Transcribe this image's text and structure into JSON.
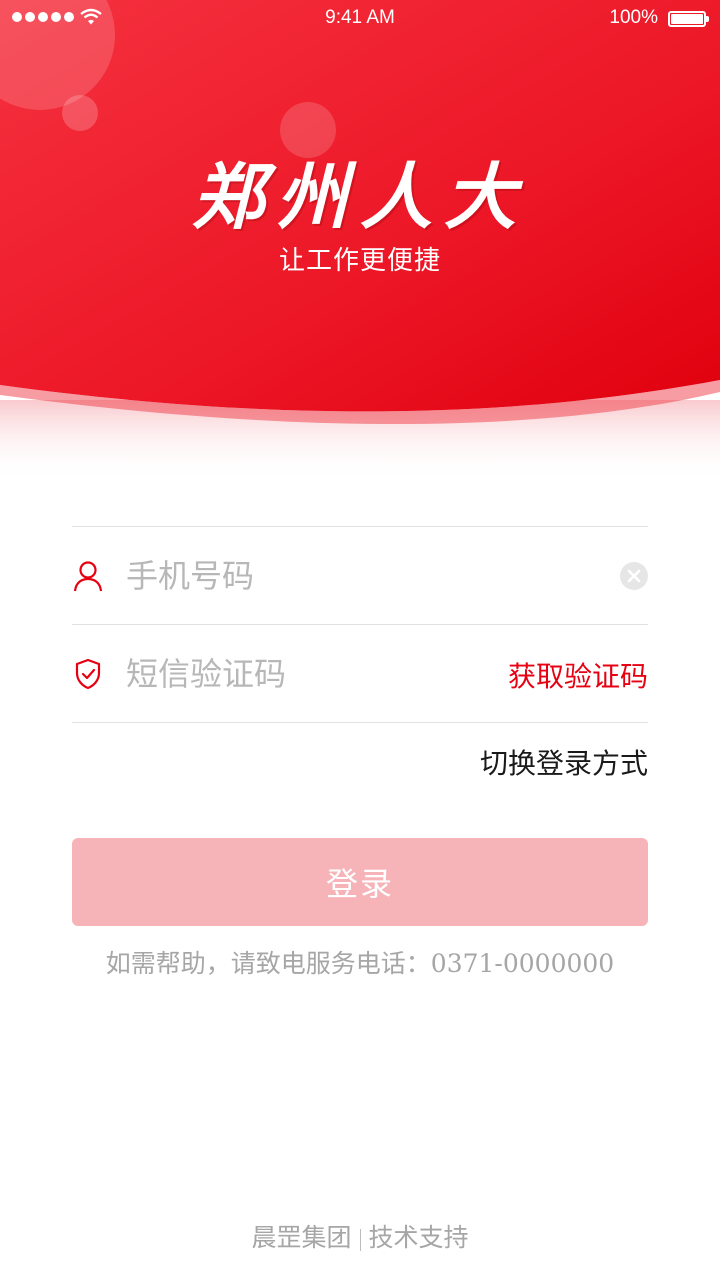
{
  "status_bar": {
    "time": "9:41 AM",
    "battery": "100%"
  },
  "header": {
    "title": "郑州人大",
    "subtitle": "让工作更便捷"
  },
  "form": {
    "phone_placeholder": "手机号码",
    "code_placeholder": "短信验证码",
    "get_code_label": "获取验证码",
    "switch_login_label": "切换登录方式",
    "login_label": "登录"
  },
  "help_text": "如需帮助，请致电服务电话：0371-0000000",
  "footer": {
    "company": "晨罡集团",
    "support": "技术支持"
  },
  "colors": {
    "brand_red": "#e60012",
    "button_disabled": "#f7b4b8"
  }
}
